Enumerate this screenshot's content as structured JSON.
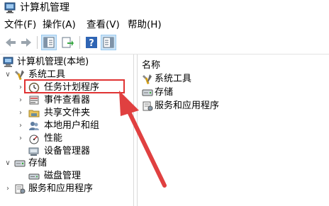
{
  "window": {
    "title": "计算机管理"
  },
  "menu": [
    "文件(F)",
    "操作(A)",
    "查看(V)",
    "帮助(H)"
  ],
  "toolbar": {
    "buttons": [
      "back-icon",
      "forward-icon",
      "show-hide-console-tree-icon",
      "export-list-icon",
      "help-icon",
      "show-action-pane-icon"
    ]
  },
  "tree": {
    "root": "计算机管理(本地)",
    "system_tools": "系统工具",
    "task_scheduler": "任务计划程序",
    "event_viewer": "事件查看器",
    "shared_folders": "共享文件夹",
    "local_users": "本地用户和组",
    "performance": "性能",
    "device_manager": "设备管理器",
    "storage": "存储",
    "disk_management": "磁盘管理",
    "services_apps": "服务和应用程序"
  },
  "list": {
    "header": "名称",
    "items": [
      "系统工具",
      "存储",
      "服务和应用程序"
    ]
  },
  "colors": {
    "highlight": "#e03333",
    "arrow": "#e04040",
    "selection": "#cce4f7"
  }
}
